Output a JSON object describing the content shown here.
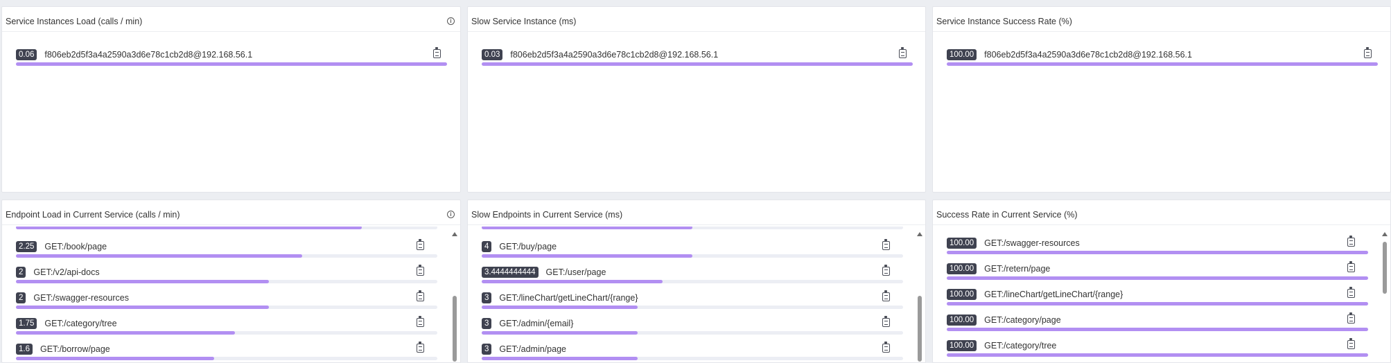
{
  "panels": [
    {
      "title": "Service Instances Load (calls / min)",
      "has_info": true,
      "rows": [
        {
          "value": "0.06",
          "name": "f806eb2d5f3a4a2590a3d6e78c1cb2d8@192.168.56.1",
          "fraction": 1.0
        }
      ]
    },
    {
      "title": "Slow Service Instance (ms)",
      "has_info": false,
      "rows": [
        {
          "value": "0.03",
          "name": "f806eb2d5f3a4a2590a3d6e78c1cb2d8@192.168.56.1",
          "fraction": 1.0
        }
      ]
    },
    {
      "title": "Service Instance Success Rate (%)",
      "has_info": false,
      "rows": [
        {
          "value": "100.00",
          "name": "f806eb2d5f3a4a2590a3d6e78c1cb2d8@192.168.56.1",
          "fraction": 1.0
        }
      ]
    },
    {
      "title": "Endpoint Load in Current Service (calls / min)",
      "has_info": true,
      "scrollable": true,
      "partial_fraction": 0.82,
      "rows": [
        {
          "value": "2.25",
          "name": "GET:/book/page",
          "fraction": 0.68
        },
        {
          "value": "2",
          "name": "GET:/v2/api-docs",
          "fraction": 0.6
        },
        {
          "value": "2",
          "name": "GET:/swagger-resources",
          "fraction": 0.6
        },
        {
          "value": "1.75",
          "name": "GET:/category/tree",
          "fraction": 0.52
        },
        {
          "value": "1.6",
          "name": "GET:/borrow/page",
          "fraction": 0.47
        }
      ]
    },
    {
      "title": "Slow Endpoints in Current Service (ms)",
      "has_info": false,
      "scrollable": true,
      "partial_fraction": 0.5,
      "rows": [
        {
          "value": "4",
          "name": "GET:/buy/page",
          "fraction": 0.5
        },
        {
          "value": "3.4444444444",
          "name": "GET:/user/page",
          "fraction": 0.43
        },
        {
          "value": "3",
          "name": "GET:/lineChart/getLineChart/{range}",
          "fraction": 0.37
        },
        {
          "value": "3",
          "name": "GET:/admin/{email}",
          "fraction": 0.37
        },
        {
          "value": "3",
          "name": "GET:/admin/page",
          "fraction": 0.37
        }
      ]
    },
    {
      "title": "Success Rate in Current Service (%)",
      "has_info": false,
      "scrollable": true,
      "rows": [
        {
          "value": "100.00",
          "name": "GET:/swagger-resources",
          "fraction": 1.0
        },
        {
          "value": "100.00",
          "name": "GET:/retern/page",
          "fraction": 1.0
        },
        {
          "value": "100.00",
          "name": "GET:/lineChart/getLineChart/{range}",
          "fraction": 1.0
        },
        {
          "value": "100.00",
          "name": "GET:/category/page",
          "fraction": 1.0
        },
        {
          "value": "100.00",
          "name": "GET:/category/tree",
          "fraction": 1.0
        }
      ]
    }
  ]
}
